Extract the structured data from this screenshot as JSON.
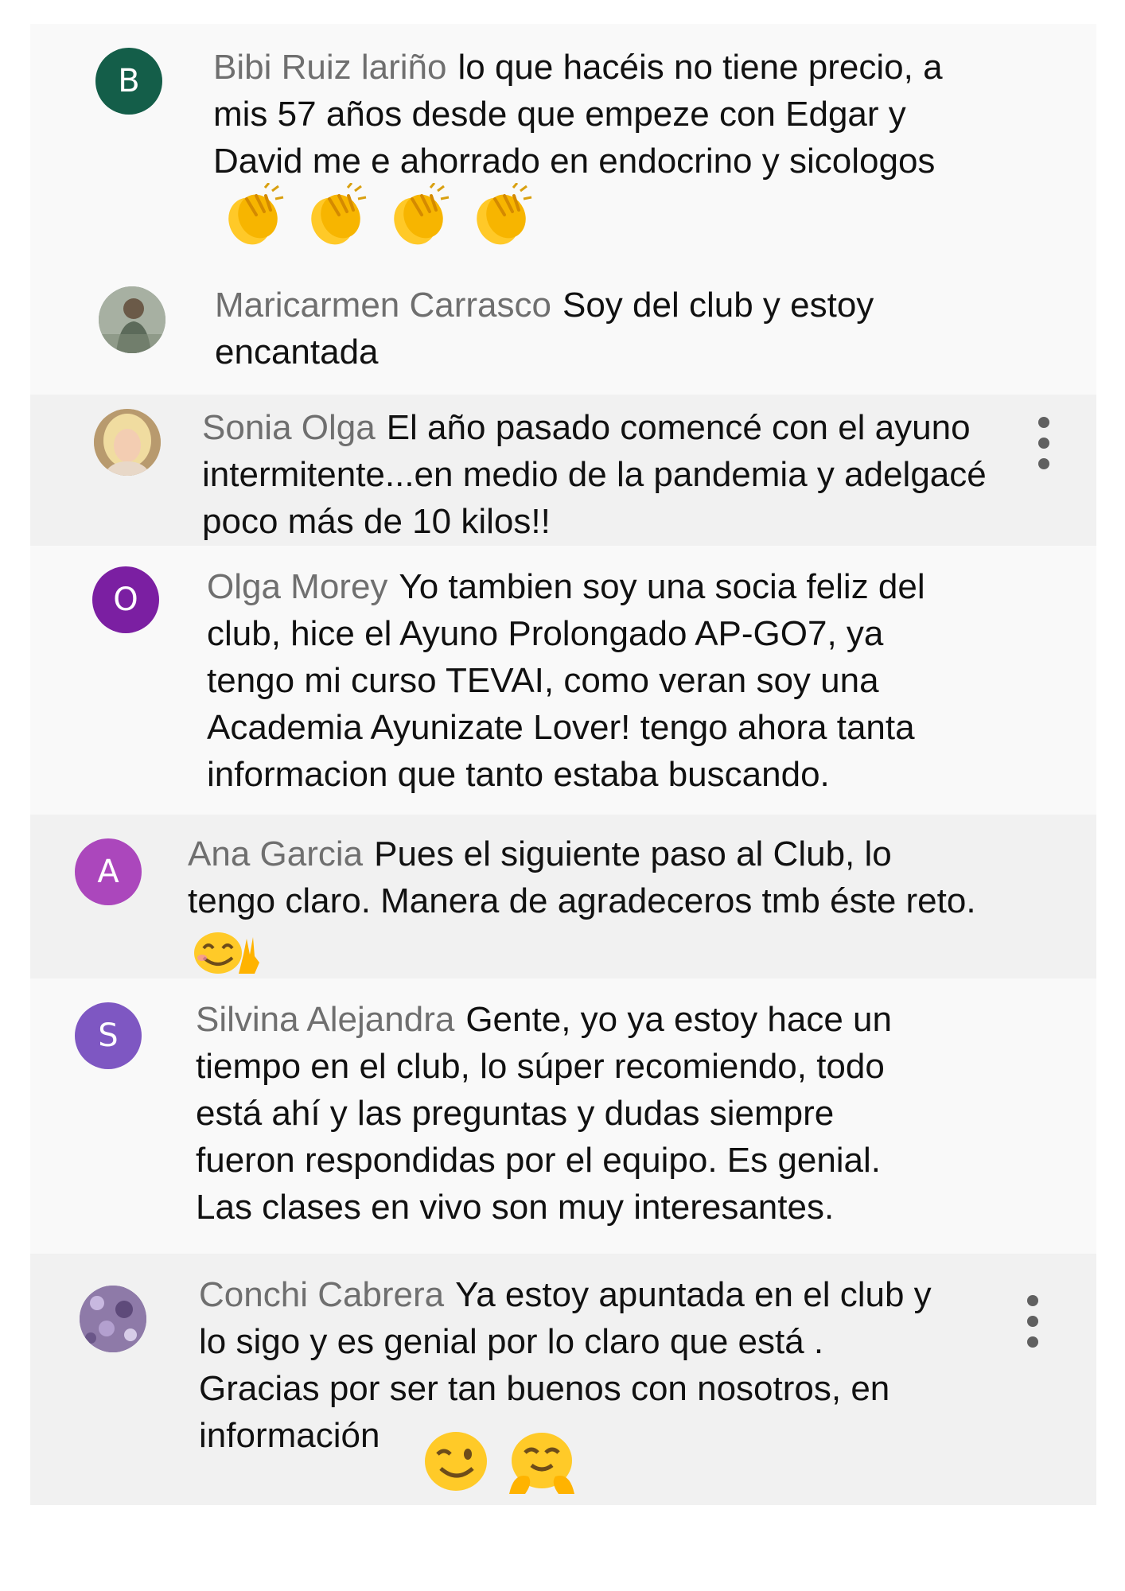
{
  "comments": [
    {
      "author": "Bibi Ruiz lariño",
      "avatar_letter": "B",
      "avatar_color": "#145e49",
      "text": "lo que hacéis no tiene precio, a\nmis 57 años desde que empeze con Edgar y\nDavid me e ahorrado en endocrino y sicologos",
      "emoji": [
        "clapping-hands",
        "clapping-hands",
        "clapping-hands",
        "clapping-hands"
      ]
    },
    {
      "author": "Maricarmen Carrasco",
      "avatar_type": "photo",
      "text": "Soy del club y estoy\nencantada"
    },
    {
      "author": "Sonia Olga",
      "avatar_type": "photo",
      "text": "El año pasado comencé con el ayuno\nintermitente...en medio de la pandemia y adelgacé\npoco más de 10 kilos!!",
      "menu_icon": "more-vertical-icon"
    },
    {
      "author": "Olga Morey",
      "avatar_letter": "O",
      "avatar_color": "#7b1fa2",
      "text": "Yo tambien soy una socia feliz del\nclub, hice el Ayuno Prolongado AP-GO7, ya\ntengo mi curso TEVAI, como veran soy una\nAcademia Ayunizate Lover! tengo ahora tanta\ninformacion que tanto estaba buscando."
    },
    {
      "author": "Ana Garcia",
      "avatar_letter": "A",
      "avatar_color": "#ab47bc",
      "text": "Pues el siguiente paso al Club, lo\ntengo claro. Manera de agradeceros tmb éste reto.",
      "emoji": [
        "smiling-face-with-victory-hand"
      ]
    },
    {
      "author": "Silvina Alejandra",
      "avatar_letter": "S",
      "avatar_color": "#7e57c2",
      "text": "Gente, yo ya estoy hace un\ntiempo en el club, lo súper recomiendo, todo\nestá ahí y las preguntas y dudas siempre\nfueron respondidas por el equipo. Es genial.\nLas clases en vivo son muy interesantes."
    },
    {
      "author": "Conchi Cabrera",
      "avatar_type": "photo",
      "text": "Ya estoy apuntada en el club y\nlo sigo y es genial por lo claro que está .\nGracias por ser tan buenos con nosotros, en\ninformación",
      "emoji": [
        "winking-face",
        "hugging-face"
      ],
      "menu_icon": "more-vertical-icon"
    }
  ]
}
